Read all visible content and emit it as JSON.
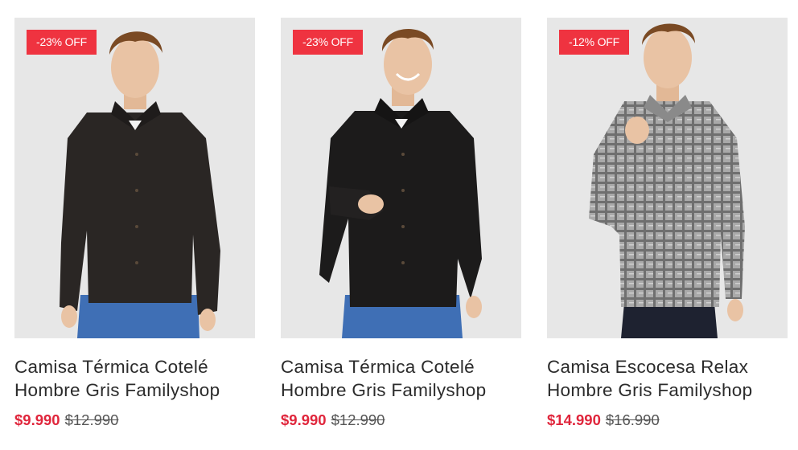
{
  "products": [
    {
      "badge": "-23% OFF",
      "title_line1": "Camisa Térmica Cotelé",
      "title_line2": "Hombre Gris Familyshop",
      "price": "$9.990",
      "old_price": "$12.990",
      "shirt_color": "#2a2624"
    },
    {
      "badge": "-23% OFF",
      "title_line1": "Camisa Térmica Cotelé",
      "title_line2": "Hombre Gris Familyshop",
      "price": "$9.990",
      "old_price": "$12.990",
      "shirt_color": "#1c1b1b"
    },
    {
      "badge": "-12% OFF",
      "title_line1": "Camisa Escocesa Relax",
      "title_line2": "Hombre Gris Familyshop",
      "price": "$14.990",
      "old_price": "$16.990",
      "shirt_color": "#9a9a9a"
    }
  ],
  "colors": {
    "badge_bg": "#ef3340",
    "sale_price": "#e0263c",
    "photo_bg": "#e7e7e7",
    "jeans": "#3f6fb5",
    "skin": "#e9c3a4",
    "hair": "#7a4a24"
  }
}
